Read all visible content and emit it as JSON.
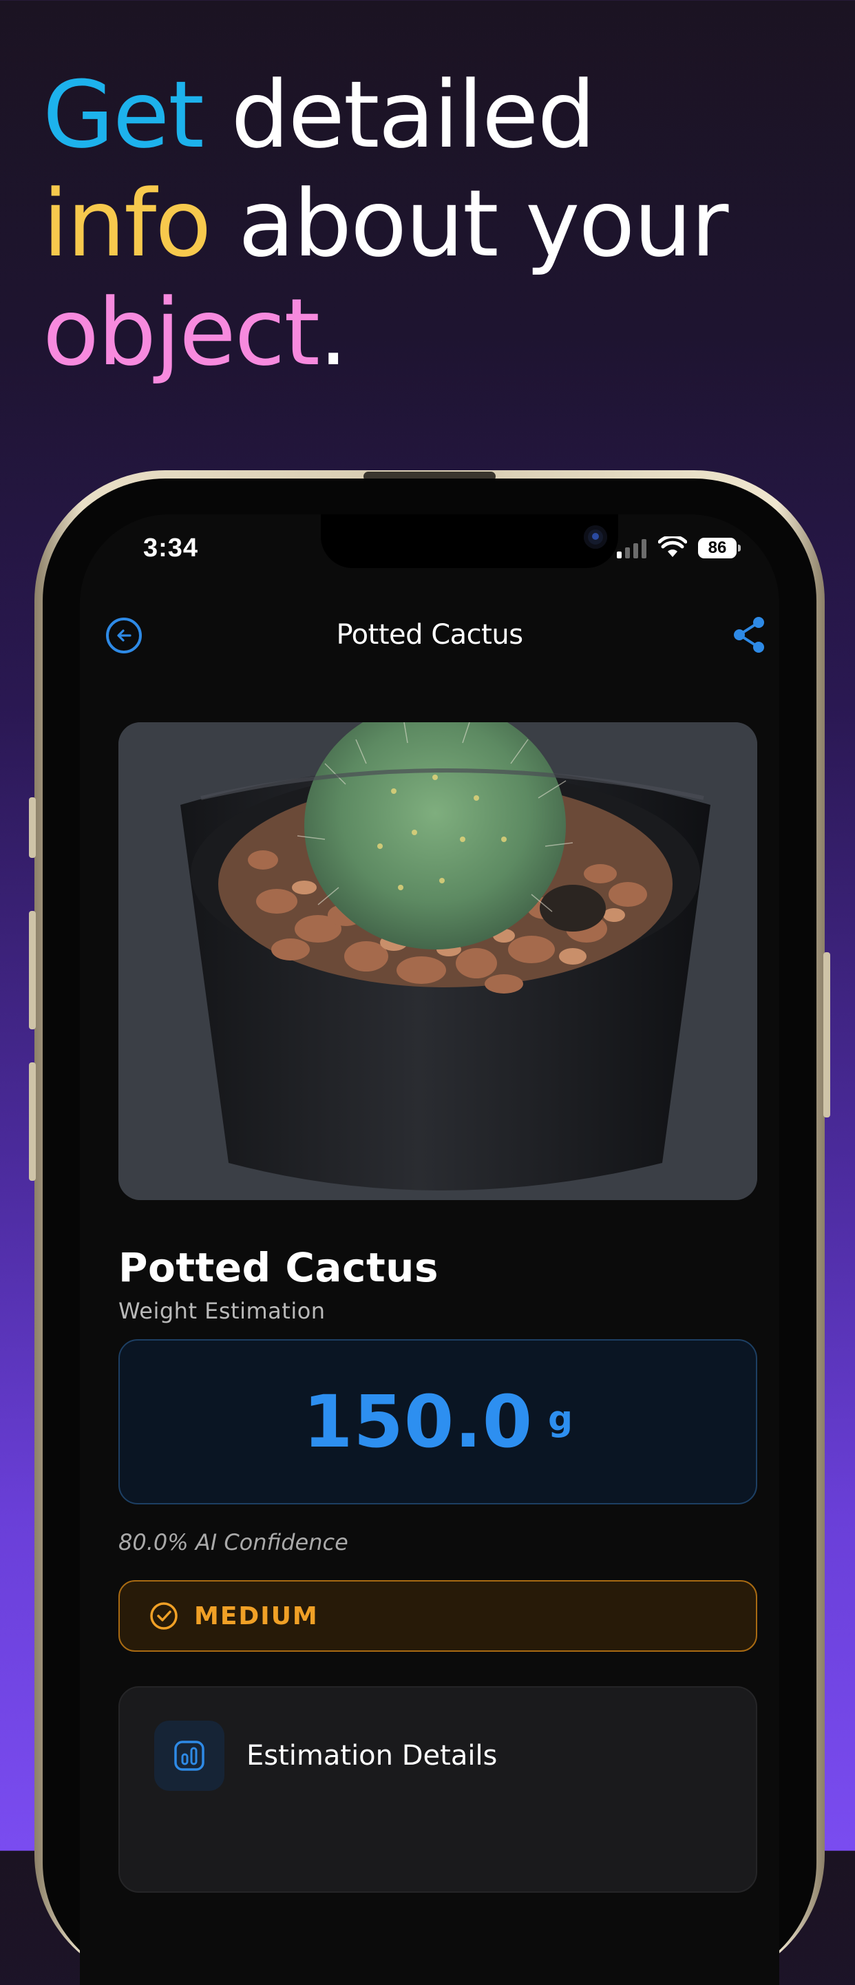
{
  "promo": {
    "words": {
      "get": "Get",
      "detailed": "detailed",
      "info": "info",
      "about_your": "about your",
      "object": "object",
      "period": "."
    }
  },
  "status_bar": {
    "time": "3:34",
    "battery": "86"
  },
  "nav": {
    "title": "Potted Cactus",
    "back_icon": "back-arrow-circle-icon",
    "share_icon": "share-icon"
  },
  "object": {
    "name": "Potted Cactus",
    "subtitle": "Weight Estimation",
    "weight_value": "150.0",
    "weight_unit": "g",
    "confidence": "80.0% AI Confidence",
    "level": "MEDIUM"
  },
  "details": {
    "title": "Estimation Details",
    "icon": "chart-icon"
  },
  "colors": {
    "accent_blue": "#2d8ff0",
    "headline_blue": "#1db2ec",
    "headline_yellow": "#f7c94d",
    "headline_pink": "#f78ade",
    "medium_orange": "#f0a026"
  }
}
